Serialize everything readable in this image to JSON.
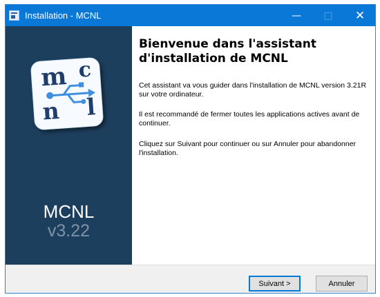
{
  "window": {
    "title": "Installation - MCNL",
    "controls": {
      "minimize_icon": "—",
      "maximize_icon": "□",
      "close_icon": "✕"
    }
  },
  "sidebar": {
    "logo_letters": [
      "m",
      "c",
      "n",
      "l"
    ],
    "product_name": "MCNL",
    "product_version": "v3.22",
    "background_color": "#1d3f5e"
  },
  "content": {
    "heading": "Bienvenue dans l'assistant d'installation de MCNL",
    "paragraphs": [
      "Cet assistant va vous guider dans l'installation de MCNL version 3.21R sur votre ordinateur.",
      "Il est recommandé de fermer toutes les applications actives avant de continuer.",
      "Cliquez sur Suivant pour continuer ou sur Annuler pour abandonner l'installation."
    ]
  },
  "footer": {
    "next_label": "Suivant >",
    "cancel_label": "Annuler"
  },
  "colors": {
    "titlebar": "#0a78d7",
    "accent": "#0078d7"
  }
}
